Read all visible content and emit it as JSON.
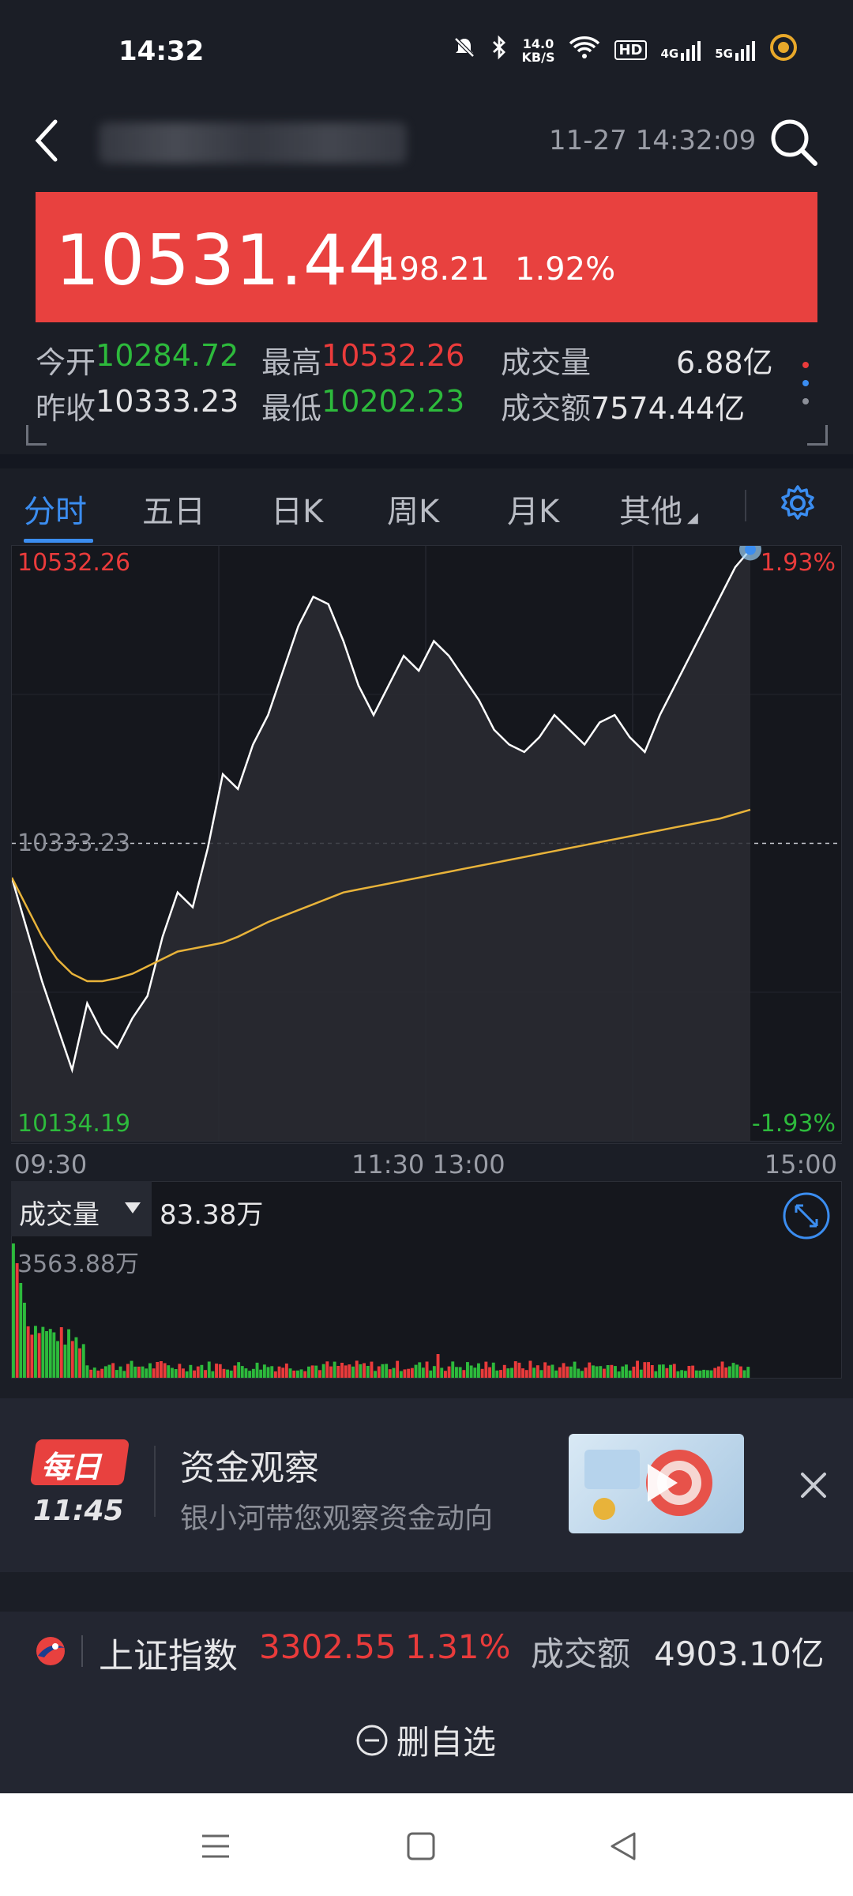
{
  "status_bar": {
    "time": "14:32",
    "net_speed_top": "14.0",
    "net_speed_unit": "KB/S",
    "hd": "HD",
    "sig1": "4G",
    "sig2": "5G"
  },
  "header": {
    "datetime": "11-27 14:32:09"
  },
  "quote": {
    "price": "10531.44",
    "change": "198.21",
    "change_pct": "1.92%"
  },
  "stats": {
    "open_label": "今开",
    "open": "10284.72",
    "high_label": "最高",
    "high": "10532.26",
    "vol_label": "成交量",
    "vol": "6.88亿",
    "prev_label": "昨收",
    "prev": "10333.23",
    "low_label": "最低",
    "low": "10202.23",
    "amt_label": "成交额",
    "amt": "7574.44亿"
  },
  "tabs": [
    "分时",
    "五日",
    "日K",
    "周K",
    "月K",
    "其他"
  ],
  "chart": {
    "top_left": "10532.26",
    "top_right": "1.93%",
    "mid_left": "10333.23",
    "bottom_left": "10134.19",
    "bottom_right": "-1.93%",
    "time_start": "09:30",
    "time_mid": "11:30 13:00",
    "time_end": "15:00"
  },
  "volume": {
    "selector_label": "成交量",
    "current": "83.38万",
    "max": "3563.88万"
  },
  "news": {
    "badge": "每日",
    "time": "11:45",
    "title": "资金观察",
    "subtitle": "银小河带您观察资金动向"
  },
  "index_bar": {
    "name": "上证指数",
    "value": "3302.55",
    "pct": "1.31%",
    "amt_label": "成交额",
    "amt": "4903.10亿"
  },
  "actions": {
    "remove_watchlist": "删自选"
  },
  "colors": {
    "up": "#ea3b3b",
    "down": "#2dba3c",
    "accent": "#3b8df0",
    "avg_line": "#e8b33a"
  },
  "chart_data": {
    "type": "line",
    "x_range": [
      "09:30",
      "15:00"
    ],
    "ylim": [
      10134.19,
      10532.26
    ],
    "reference": 10333.23,
    "series": [
      {
        "values": [
          10310,
          10275,
          10240,
          10210,
          10180,
          10225,
          10205,
          10195,
          10215,
          10230,
          10270,
          10300,
          10290,
          10330,
          10380,
          10370,
          10400,
          10420,
          10450,
          10480,
          10500,
          10495,
          10470,
          10440,
          10420,
          10440,
          10460,
          10450,
          10470,
          10460,
          10445,
          10430,
          10410,
          10400,
          10395,
          10405,
          10420,
          10410,
          10400,
          10415,
          10420,
          10405,
          10395,
          10420,
          10440,
          10460,
          10480,
          10500,
          10520,
          10532
        ]
      },
      {
        "values": [
          10310,
          10290,
          10270,
          10255,
          10245,
          10240,
          10240,
          10242,
          10245,
          10250,
          10255,
          10260,
          10262,
          10264,
          10266,
          10270,
          10275,
          10280,
          10284,
          10288,
          10292,
          10296,
          10300,
          10302,
          10304,
          10306,
          10308,
          10310,
          10312,
          10314,
          10316,
          10318,
          10320,
          10322,
          10324,
          10326,
          10328,
          10330,
          10332,
          10334,
          10336,
          10338,
          10340,
          10342,
          10344,
          10346,
          10348,
          10350,
          10353,
          10356
        ]
      }
    ]
  }
}
